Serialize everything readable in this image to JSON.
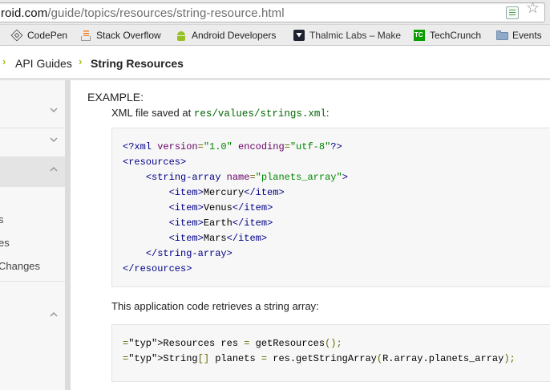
{
  "urlbar": {
    "host": "roid.com",
    "path": "/guide/topics/resources/string-resource.html"
  },
  "bookmarks": [
    {
      "label": "CodePen",
      "icon": "codepen-icon"
    },
    {
      "label": "Stack Overflow",
      "icon": "stackoverflow-icon"
    },
    {
      "label": "Android Developers",
      "icon": "android-icon"
    },
    {
      "label": "Thalmic Labs – Make",
      "icon": "thalmic-icon"
    },
    {
      "label": "TechCrunch",
      "icon": "techcrunch-icon"
    },
    {
      "label": "Events",
      "icon": "folder-icon"
    }
  ],
  "breadcrumb": {
    "items": [
      "API Guides",
      "String Resources"
    ]
  },
  "leftnav": {
    "items": [
      "s",
      "es",
      "Changes"
    ]
  },
  "content": {
    "example_label": "EXAMPLE:",
    "xml_intro_prefix": "XML file saved at ",
    "xml_path": "res/values/strings.xml",
    "xml_intro_suffix": ":",
    "xml_lines": [
      "<?xml version=\"1.0\" encoding=\"utf-8\"?>",
      "<resources>",
      "    <string-array name=\"planets_array\">",
      "        <item>Mercury</item>",
      "        <item>Venus</item>",
      "        <item>Earth</item>",
      "        <item>Mars</item>",
      "    </string-array>",
      "</resources>"
    ],
    "code_intro": "This application code retrieves a string array:",
    "java_lines": [
      "Resources res = getResources();",
      "String[] planets = res.getStringArray(R.array.planets_array);"
    ]
  },
  "colors": {
    "breadcrumb_arrow": "#9cc41c",
    "code_tag": "#000088",
    "code_string": "#008800",
    "code_attr": "#660066",
    "inline_code": "#006600"
  }
}
